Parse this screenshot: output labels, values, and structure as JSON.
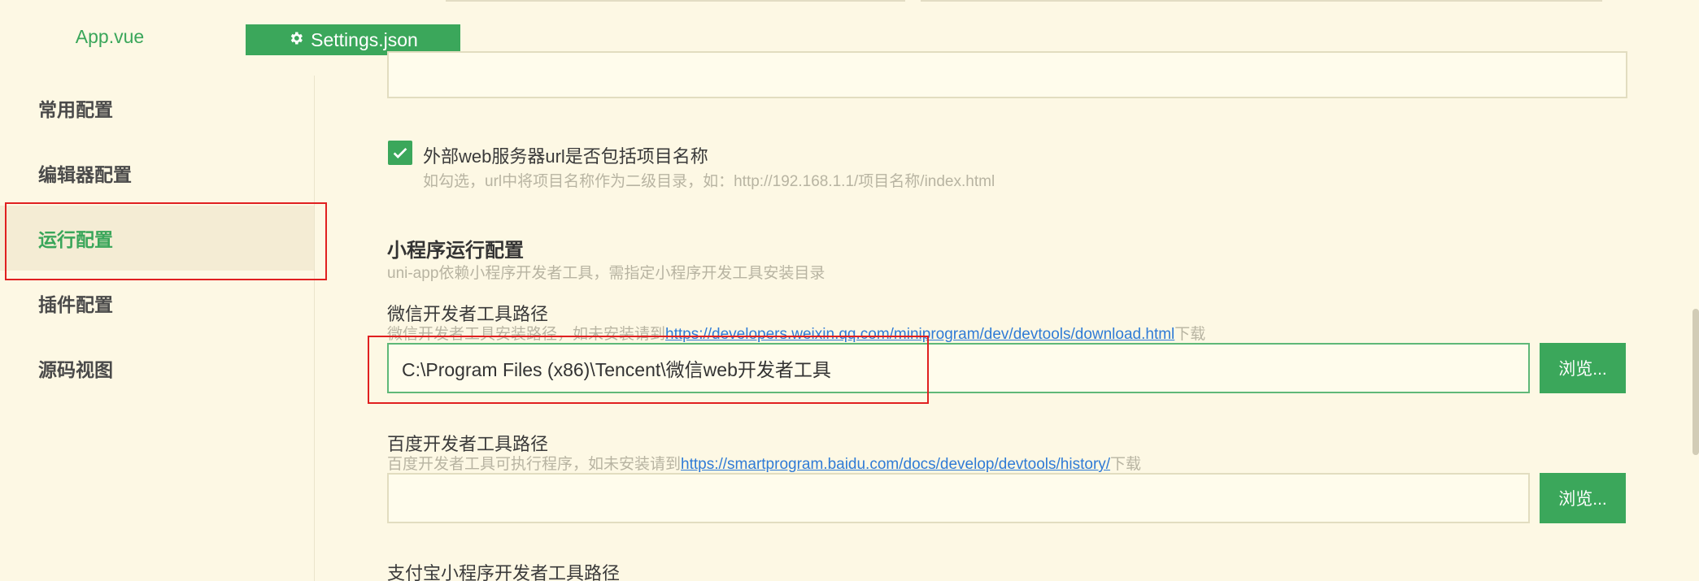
{
  "tabs": [
    {
      "label": "App.vue",
      "active": false
    },
    {
      "label": "Settings.json",
      "active": true,
      "icon": "gear-icon"
    }
  ],
  "sidebar": {
    "items": [
      {
        "label": "常用配置",
        "active": false
      },
      {
        "label": "编辑器配置",
        "active": false
      },
      {
        "label": "运行配置",
        "active": true
      },
      {
        "label": "插件配置",
        "active": false
      },
      {
        "label": "源码视图",
        "active": false
      }
    ]
  },
  "main": {
    "top_input": {
      "value": ""
    },
    "external_url_option": {
      "checked": true,
      "label": "外部web服务器url是否包括项目名称",
      "hint": "如勾选，url中将项目名称作为二级目录，如：http://192.168.1.1/项目名称/index.html"
    },
    "miniprogram_section": {
      "title": "小程序运行配置",
      "subtitle": "uni-app依赖小程序开发者工具，需指定小程序开发工具安装目录"
    },
    "wechat": {
      "label": "微信开发者工具路径",
      "hint_prefix": "微信开发者工具安装路径，如未安装请到",
      "hint_link": "https://developers.weixin.qq.com/miniprogram/dev/devtools/download.html",
      "hint_suffix": "下载",
      "value": "C:\\Program Files (x86)\\Tencent\\微信web开发者工具",
      "browse_label": "浏览..."
    },
    "baidu": {
      "label": "百度开发者工具路径",
      "hint_prefix": "百度开发者工具可执行程序，如未安装请到",
      "hint_link": "https://smartprogram.baidu.com/docs/develop/devtools/history/",
      "hint_suffix": "下载",
      "value": "",
      "browse_label": "浏览..."
    },
    "alipay": {
      "label": "支付宝小程序开发者工具路径"
    }
  },
  "colors": {
    "accent": "#3ba75b",
    "background": "#fdf8e4",
    "highlight_box": "#e02020",
    "link": "#2f7bd6"
  }
}
